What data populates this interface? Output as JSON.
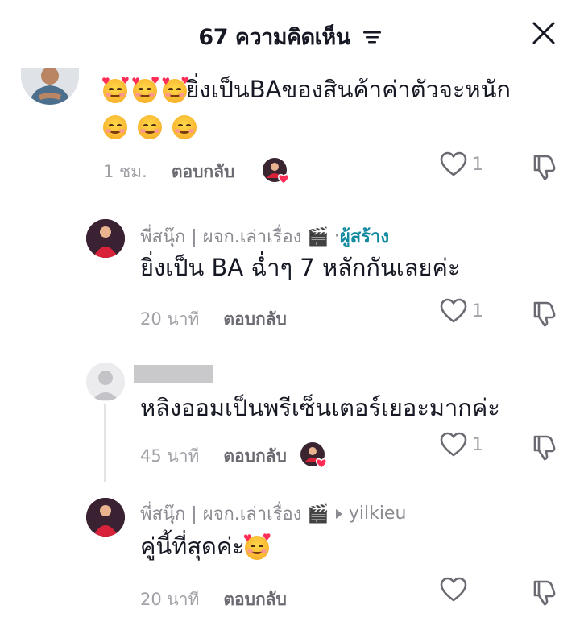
{
  "header": {
    "title": "67 ความคิดเห็น",
    "sort_icon": "sort-lines-icon",
    "close_icon": "close-icon"
  },
  "comments": [
    {
      "author": "",
      "text": "ยิ่งเป็นBAของสินค้าค่าตัวจะหนัก",
      "emoji_prefix": "smiling-face-with-hearts",
      "emoji_suffix": "smiling-face-with-smiling-eyes",
      "time": "1 ชม.",
      "reply_label": "ตอบกลับ",
      "likes": "1"
    },
    {
      "author": "พี่สนุ๊ก | ผจก.เล่าเรื่อง 🎬",
      "creator_tag": "ผู้สร้าง",
      "text": "ยิ่งเป็น BA ฉ่ำๆ 7 หลักกันเลยค่ะ",
      "time": "20 นาที",
      "reply_label": "ตอบกลับ",
      "likes": "1"
    },
    {
      "author": "",
      "text": "หลิงออมเป็นพรีเซ็นเตอร์เยอะมากค่ะ",
      "time": "45 นาที",
      "reply_label": "ตอบกลับ",
      "likes": "1"
    },
    {
      "author": "พี่สนุ๊ก | ผจก.เล่าเรื่อง 🎬",
      "reply_to": "yilkieu",
      "text": "คู่นี้ที่สุดค่ะ",
      "time": "20 นาที",
      "reply_label": "ตอบกลับ",
      "likes": ""
    }
  ],
  "colors": {
    "creator_tag": "#10899e",
    "muted_text": "#a0a1a7",
    "primary_text": "#161823"
  }
}
